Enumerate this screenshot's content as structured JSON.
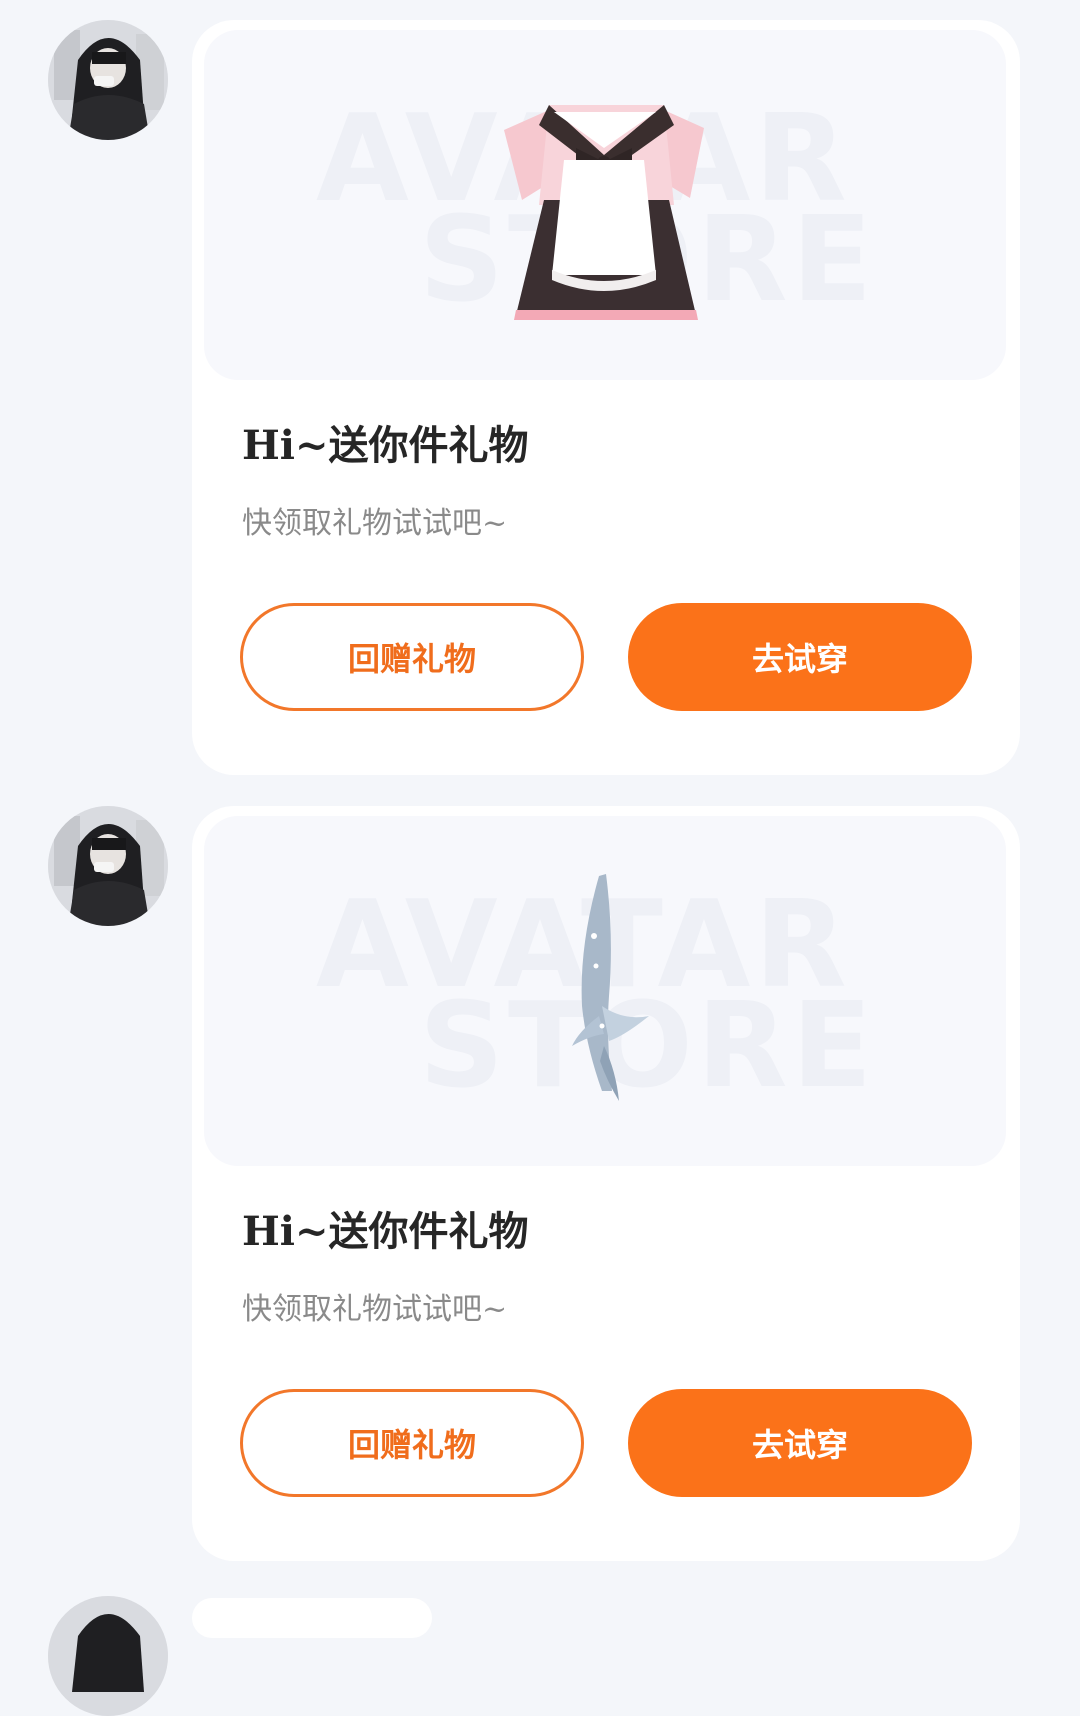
{
  "colors": {
    "background": "#f4f6fa",
    "accent": "#fb7219",
    "title": "#262626",
    "subtitle": "#8a8a8a"
  },
  "messages": [
    {
      "avatar_icon": "user-avatar",
      "item_icon": "maid-dress-icon",
      "watermark": [
        "AVATAR",
        "STORE"
      ],
      "title": "Hi~送你件礼物",
      "subtitle": "快领取礼物试试吧~",
      "secondary_button": "回赠礼物",
      "primary_button": "去试穿"
    },
    {
      "avatar_icon": "user-avatar",
      "item_icon": "fish-tail-icon",
      "watermark": [
        "AVATAR",
        "STORE"
      ],
      "title": "Hi~送你件礼物",
      "subtitle": "快领取礼物试试吧~",
      "secondary_button": "回赠礼物",
      "primary_button": "去试穿"
    }
  ]
}
